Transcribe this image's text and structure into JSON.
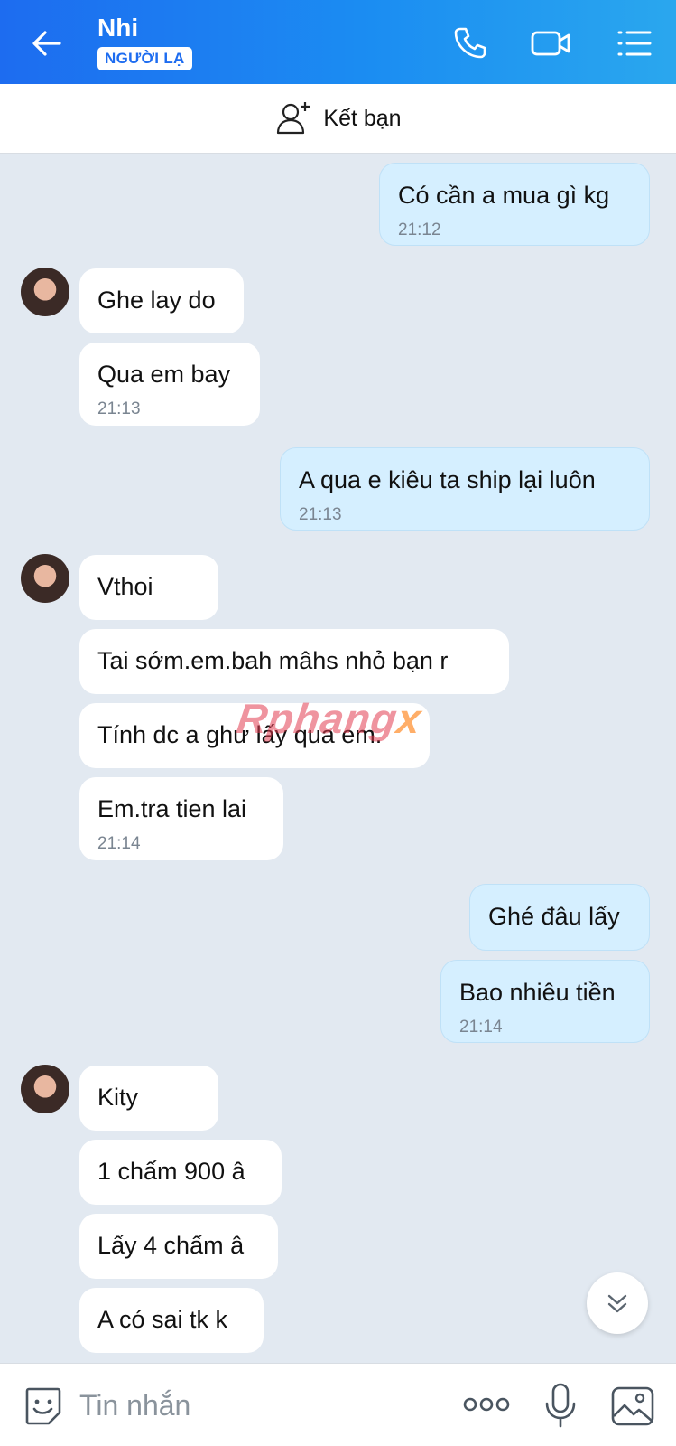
{
  "header": {
    "title": "Nhi",
    "badge": "NGƯỜI LẠ",
    "icons": [
      "back-arrow-icon",
      "phone-icon",
      "video-call-icon",
      "menu-list-icon"
    ]
  },
  "add_friend": {
    "label": "Kết bạn",
    "icon": "add-user-icon"
  },
  "messages": [
    {
      "dir": "out",
      "text": "Có cần a mua gì kg",
      "time": "21:12"
    },
    {
      "dir": "in",
      "text": "Ghe lay do",
      "time": ""
    },
    {
      "dir": "in",
      "text": "Qua em bay",
      "time": "21:13"
    },
    {
      "dir": "out",
      "text": "A qua e kiêu ta ship lại luôn",
      "time": "21:13"
    },
    {
      "dir": "in",
      "text": "Vthoi",
      "time": ""
    },
    {
      "dir": "in",
      "text": "Tai sớm.em.bah mâhs nhỏ bạn r",
      "time": ""
    },
    {
      "dir": "in",
      "text": "Tính dc a ghư lấy qua em.",
      "time": ""
    },
    {
      "dir": "in",
      "text": "Em.tra tien lai",
      "time": "21:14"
    },
    {
      "dir": "out",
      "text": "Ghé đâu lấy",
      "time": ""
    },
    {
      "dir": "out",
      "text": "Bao nhiêu tiền",
      "time": "21:14"
    },
    {
      "dir": "in",
      "text": "Kity",
      "time": ""
    },
    {
      "dir": "in",
      "text": "1 chấm 900 â",
      "time": ""
    },
    {
      "dir": "in",
      "text": "Lấy 4 chấm â",
      "time": ""
    },
    {
      "dir": "in",
      "text": "A có sai tk k",
      "time": ""
    }
  ],
  "watermark": {
    "main": "Rphang",
    "suffix": "x"
  },
  "composer": {
    "placeholder": "Tin nhắn",
    "icons": [
      "sticker-icon",
      "more-icon",
      "microphone-icon",
      "gallery-icon"
    ]
  },
  "colors": {
    "header_start": "#1d6cf0",
    "header_end": "#2aa7ee",
    "outgoing_bubble": "#d5efff",
    "incoming_bubble": "#ffffff",
    "chat_background": "#e2e9f1"
  }
}
